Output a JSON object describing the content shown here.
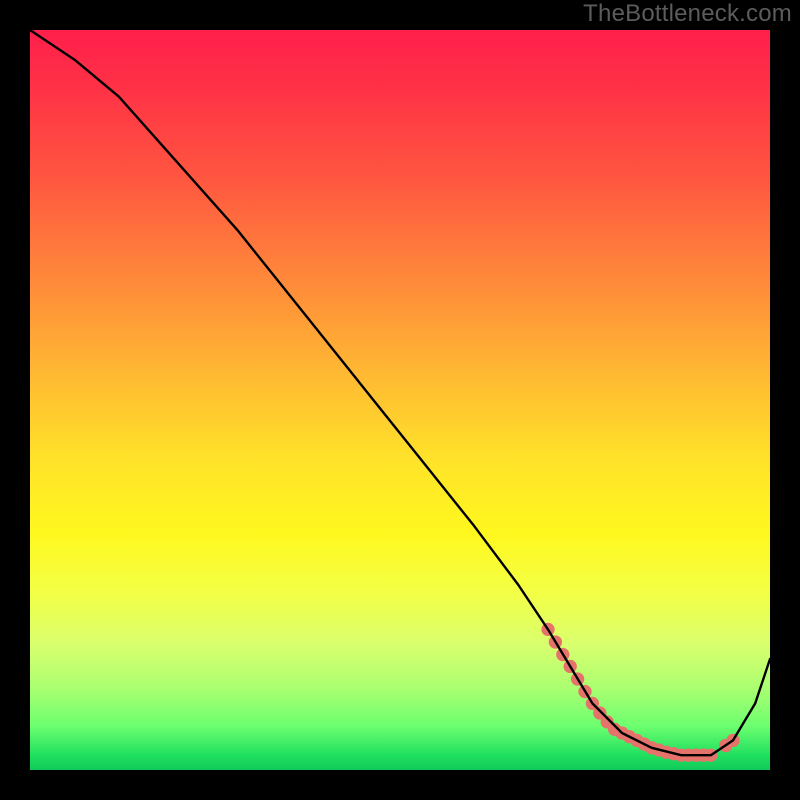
{
  "watermark": "TheBottleneck.com",
  "chart_data": {
    "type": "line",
    "title": "",
    "xlabel": "",
    "ylabel": "",
    "xlim": [
      0,
      100
    ],
    "ylim": [
      0,
      100
    ],
    "grid": false,
    "series": [
      {
        "name": "curve",
        "color": "#000000",
        "x": [
          0,
          6,
          12,
          20,
          28,
          36,
          44,
          52,
          60,
          66,
          70,
          73,
          76,
          80,
          84,
          88,
          92,
          95,
          98,
          100
        ],
        "y": [
          100,
          96,
          91,
          82,
          73,
          63,
          53,
          43,
          33,
          25,
          19,
          14,
          9,
          5,
          3,
          2,
          2,
          4,
          9,
          15
        ]
      }
    ],
    "markers": [
      {
        "name": "salmon-dots",
        "color": "#e6736b",
        "radius_norm": 0.9,
        "points": [
          {
            "x": 70.0,
            "y": 19.0
          },
          {
            "x": 71.0,
            "y": 17.3
          },
          {
            "x": 72.0,
            "y": 15.6
          },
          {
            "x": 73.0,
            "y": 14.0
          },
          {
            "x": 74.0,
            "y": 12.3
          },
          {
            "x": 75.0,
            "y": 10.6
          },
          {
            "x": 76.0,
            "y": 9.0
          },
          {
            "x": 77.0,
            "y": 7.7
          },
          {
            "x": 78.0,
            "y": 6.5
          },
          {
            "x": 79.0,
            "y": 5.5
          },
          {
            "x": 80.0,
            "y": 5.0
          },
          {
            "x": 81.0,
            "y": 4.5
          },
          {
            "x": 82.0,
            "y": 4.0
          },
          {
            "x": 83.0,
            "y": 3.5
          },
          {
            "x": 84.0,
            "y": 3.0
          },
          {
            "x": 85.0,
            "y": 2.7
          },
          {
            "x": 86.0,
            "y": 2.4
          },
          {
            "x": 87.0,
            "y": 2.2
          },
          {
            "x": 88.0,
            "y": 2.0
          },
          {
            "x": 89.0,
            "y": 2.0
          },
          {
            "x": 90.0,
            "y": 2.0
          },
          {
            "x": 91.0,
            "y": 2.0
          },
          {
            "x": 92.0,
            "y": 2.0
          },
          {
            "x": 94.0,
            "y": 3.3
          },
          {
            "x": 95.0,
            "y": 4.0
          }
        ]
      }
    ]
  }
}
